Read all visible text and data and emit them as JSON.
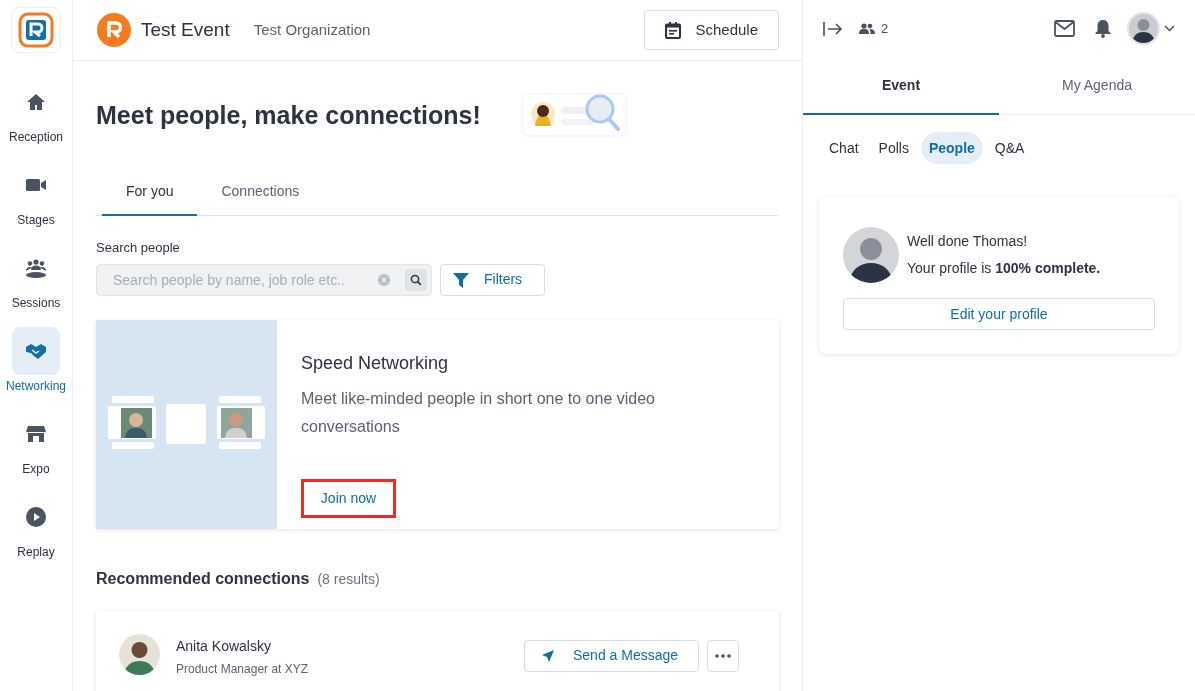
{
  "sidebar": {
    "items": [
      {
        "label": "Reception",
        "selected": false
      },
      {
        "label": "Stages",
        "selected": false
      },
      {
        "label": "Sessions",
        "selected": false
      },
      {
        "label": "Networking",
        "selected": true
      },
      {
        "label": "Expo",
        "selected": false
      },
      {
        "label": "Replay",
        "selected": false
      }
    ]
  },
  "header": {
    "event_title": "Test Event",
    "organization": "Test Organization",
    "schedule_button": "Schedule"
  },
  "main": {
    "heading": "Meet people, make connections!",
    "tabs": [
      {
        "label": "For you",
        "selected": true
      },
      {
        "label": "Connections",
        "selected": false
      }
    ],
    "search": {
      "label": "Search people",
      "placeholder": "Search people by name, job role etc.."
    },
    "filters_button": "Filters",
    "speed_networking": {
      "title": "Speed Networking",
      "description": "Meet like-minded people in short one to one video conversations",
      "join_button": "Join now",
      "highlighted": true
    },
    "recommended": {
      "title": "Recommended connections",
      "count": "(8 results)",
      "people": [
        {
          "name": "Anita Kowalsky",
          "role": "Product Manager at XYZ",
          "message_button": "Send a Message"
        }
      ]
    }
  },
  "right_panel": {
    "attendees": "2",
    "tabs": [
      {
        "label": "Event",
        "selected": true
      },
      {
        "label": "My Agenda",
        "selected": false
      }
    ],
    "subtabs": [
      {
        "label": "Chat",
        "selected": false
      },
      {
        "label": "Polls",
        "selected": false
      },
      {
        "label": "People",
        "selected": true
      },
      {
        "label": "Q&A",
        "selected": false
      }
    ],
    "profile_card": {
      "greeting": "Well done Thomas!",
      "status": "Your profile is **100% complete.**",
      "edit_button": "Edit your profile"
    }
  }
}
